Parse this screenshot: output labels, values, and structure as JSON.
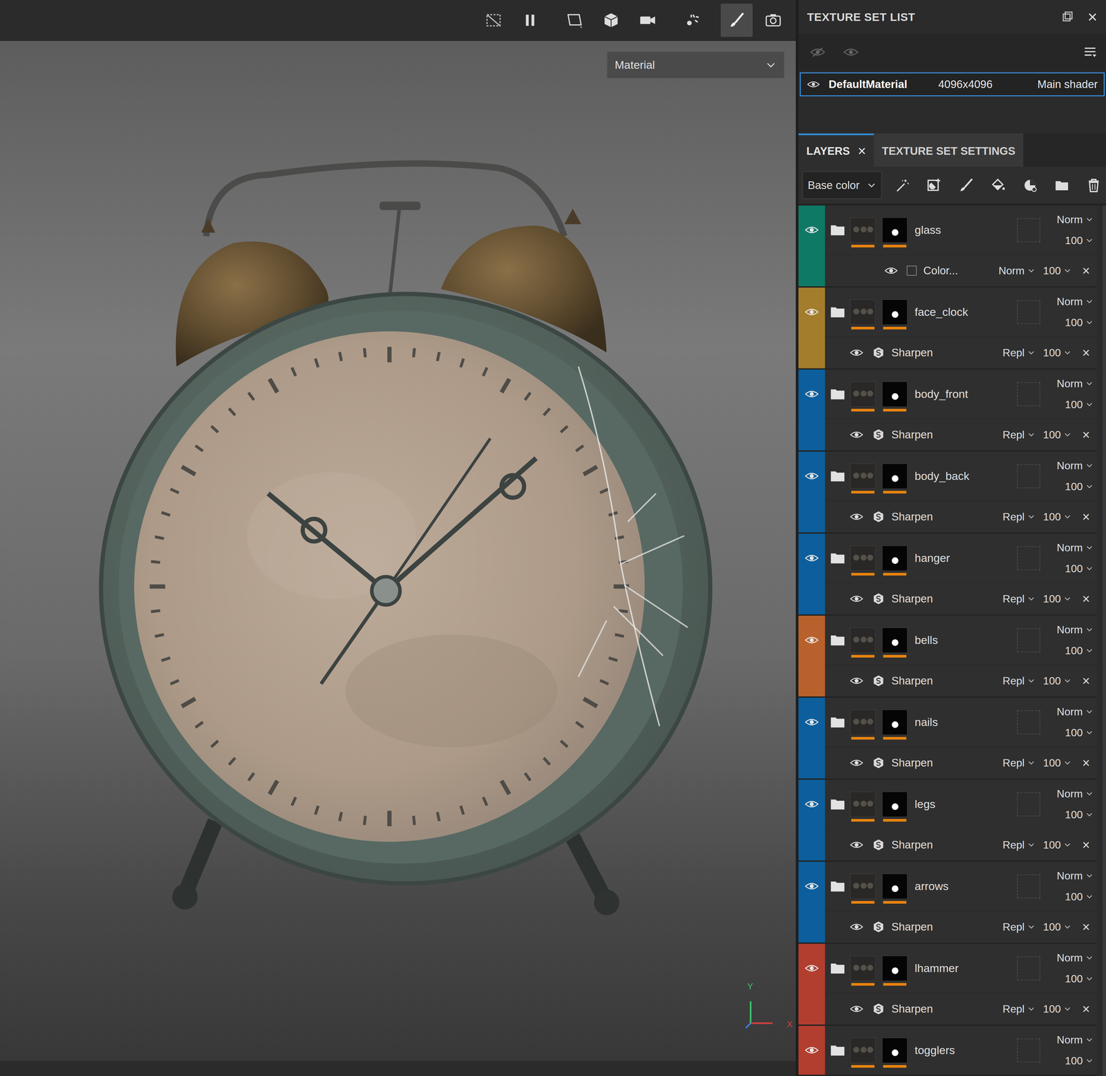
{
  "viewport": {
    "toolbar": [
      {
        "selected": false
      },
      {
        "selected": false
      },
      {
        "selected": false
      },
      {
        "selected": false
      },
      {
        "selected": false
      },
      {
        "selected": false
      },
      {
        "selected": true
      },
      {
        "selected": false
      }
    ],
    "view_mode": "Material",
    "axis": {
      "x": "X",
      "y": "Y"
    }
  },
  "texture_set_list": {
    "title": "TEXTURE SET LIST",
    "sets": [
      {
        "name": "DefaultMaterial",
        "resolution": "4096x4096",
        "shader": "Main shader",
        "visible": true,
        "selected": true
      }
    ]
  },
  "tabs": [
    {
      "label": "LAYERS",
      "closable": true,
      "selected": true
    },
    {
      "label": "TEXTURE SET SETTINGS",
      "closable": false,
      "selected": false
    }
  ],
  "close_glyph": "×",
  "channel": "Base color",
  "layers": [
    {
      "name": "glass",
      "color": "#0e7a66",
      "visible": true,
      "blend": "Norm",
      "opacity": "100",
      "effect": {
        "name": "Color...",
        "kind": "fill",
        "visible": true,
        "blend": "Norm",
        "opacity": "100"
      }
    },
    {
      "name": "face_clock",
      "color": "#a37d2c",
      "visible": true,
      "blend": "Norm",
      "opacity": "100",
      "effect": {
        "name": "Sharpen",
        "kind": "filter",
        "visible": true,
        "blend": "Repl",
        "opacity": "100"
      }
    },
    {
      "name": "body_front",
      "color": "#0c5f9c",
      "visible": true,
      "blend": "Norm",
      "opacity": "100",
      "effect": {
        "name": "Sharpen",
        "kind": "filter",
        "visible": true,
        "blend": "Repl",
        "opacity": "100"
      }
    },
    {
      "name": "body_back",
      "color": "#0c5f9c",
      "visible": true,
      "blend": "Norm",
      "opacity": "100",
      "effect": {
        "name": "Sharpen",
        "kind": "filter",
        "visible": true,
        "blend": "Repl",
        "opacity": "100"
      }
    },
    {
      "name": "hanger",
      "color": "#0c5f9c",
      "visible": true,
      "blend": "Norm",
      "opacity": "100",
      "effect": {
        "name": "Sharpen",
        "kind": "filter",
        "visible": true,
        "blend": "Repl",
        "opacity": "100"
      }
    },
    {
      "name": "bells",
      "color": "#b9612c",
      "visible": true,
      "blend": "Norm",
      "opacity": "100",
      "effect": {
        "name": "Sharpen",
        "kind": "filter",
        "visible": true,
        "blend": "Repl",
        "opacity": "100"
      }
    },
    {
      "name": "nails",
      "color": "#0c5f9c",
      "visible": true,
      "blend": "Norm",
      "opacity": "100",
      "effect": {
        "name": "Sharpen",
        "kind": "filter",
        "visible": true,
        "blend": "Repl",
        "opacity": "100"
      }
    },
    {
      "name": "legs",
      "color": "#0c5f9c",
      "visible": true,
      "blend": "Norm",
      "opacity": "100",
      "effect": {
        "name": "Sharpen",
        "kind": "filter",
        "visible": true,
        "blend": "Repl",
        "opacity": "100"
      }
    },
    {
      "name": "arrows",
      "color": "#0c5f9c",
      "visible": true,
      "blend": "Norm",
      "opacity": "100",
      "effect": {
        "name": "Sharpen",
        "kind": "filter",
        "visible": true,
        "blend": "Repl",
        "opacity": "100"
      }
    },
    {
      "name": "lhammer",
      "color": "#b23e2f",
      "visible": true,
      "blend": "Norm",
      "opacity": "100",
      "effect": {
        "name": "Sharpen",
        "kind": "filter",
        "visible": true,
        "blend": "Repl",
        "opacity": "100"
      }
    },
    {
      "name": "togglers",
      "color": "#b23e2f",
      "visible": true,
      "blend": "Norm",
      "opacity": "100",
      "effect": null
    }
  ]
}
